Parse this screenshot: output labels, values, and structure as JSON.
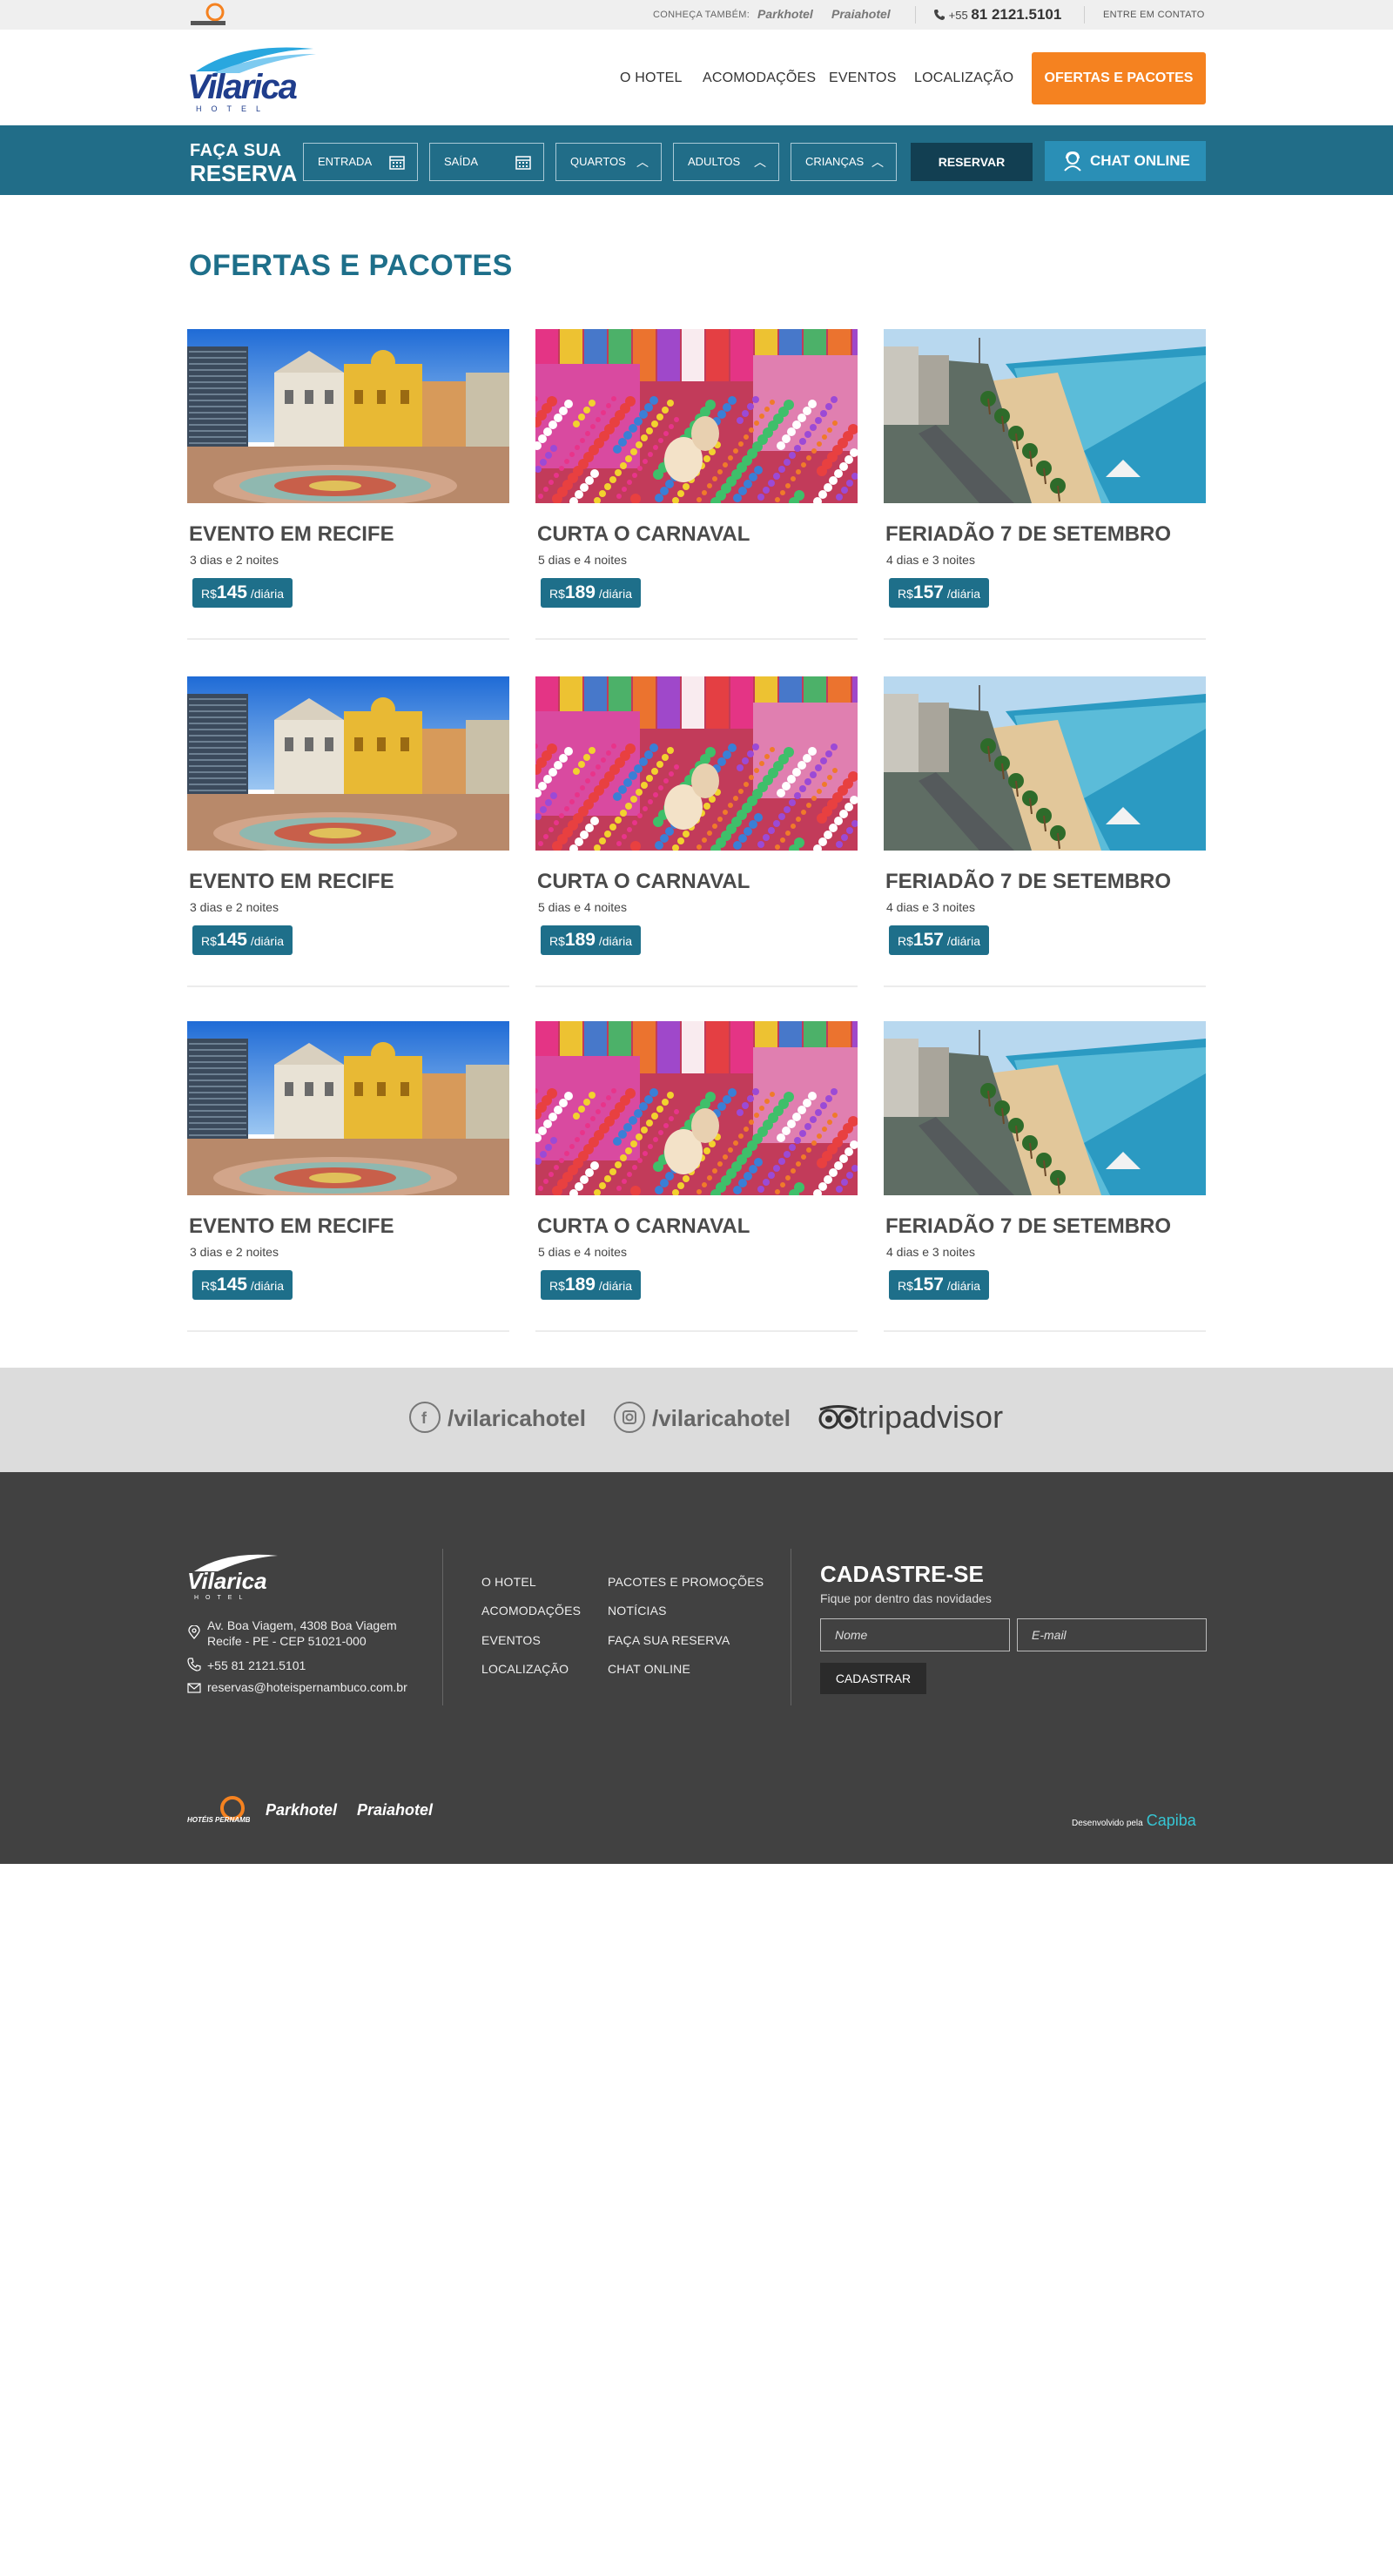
{
  "topbar": {
    "also_label": "CONHEÇA TAMBÉM:",
    "brand1": "Parkhotel",
    "brand2": "Praiahotel",
    "phone_prefix": "+55",
    "phone_number": "81 2121.5101",
    "contact": "ENTRE EM CONTATO"
  },
  "logo": {
    "name": "Vilarica",
    "sub": "HOTEL"
  },
  "nav": {
    "items": [
      "O HOTEL",
      "ACOMODAÇÕES",
      "EVENTOS",
      "LOCALIZAÇÃO"
    ],
    "cta": "OFERTAS E PACOTES"
  },
  "reservation": {
    "title_top": "FAÇA SUA",
    "title_bottom": "RESERVA",
    "entrada": "ENTRADA",
    "saida": "SAÍDA",
    "quartos": "QUARTOS",
    "adultos": "ADULTOS",
    "criancas": "CRIANÇAS",
    "submit": "RESERVAR",
    "chat": "CHAT ONLINE"
  },
  "main": {
    "title": "OFERTAS E PACOTES",
    "cards": [
      {
        "title": "EVENTO EM RECIFE",
        "duration": "3 dias e 2 noites",
        "currency": "R$",
        "price": "145",
        "unit": " /diária"
      },
      {
        "title": "CURTA O CARNAVAL",
        "duration": "5 dias e 4 noites",
        "currency": "R$",
        "price": "189",
        "unit": " /diária"
      },
      {
        "title": "FERIADÃO 7 DE SETEMBRO",
        "duration": "4 dias e 3 noites",
        "currency": "R$",
        "price": "157",
        "unit": " /diária"
      },
      {
        "title": "EVENTO EM RECIFE",
        "duration": "3 dias e 2 noites",
        "currency": "R$",
        "price": "145",
        "unit": " /diária"
      },
      {
        "title": "CURTA O CARNAVAL",
        "duration": "5 dias e 4 noites",
        "currency": "R$",
        "price": "189",
        "unit": " /diária"
      },
      {
        "title": "FERIADÃO 7 DE SETEMBRO",
        "duration": "4 dias e 3 noites",
        "currency": "R$",
        "price": "157",
        "unit": " /diária"
      },
      {
        "title": "EVENTO EM RECIFE",
        "duration": "3 dias e 2 noites",
        "currency": "R$",
        "price": "145",
        "unit": " /diária"
      },
      {
        "title": "CURTA O CARNAVAL",
        "duration": "5 dias e 4 noites",
        "currency": "R$",
        "price": "189",
        "unit": " /diária"
      },
      {
        "title": "FERIADÃO 7 DE SETEMBRO",
        "duration": "4 dias e 3 noites",
        "currency": "R$",
        "price": "157",
        "unit": " /diária"
      }
    ]
  },
  "social": {
    "facebook": "/vilaricahotel",
    "instagram": "/vilaricahotel",
    "tripadvisor": "tripadvisor"
  },
  "footer": {
    "address_line1": "Av. Boa Viagem, 4308 Boa Viagem",
    "address_line2": "Recife - PE - CEP 51021-000",
    "phone": "+55 81 2121.5101",
    "email": "reservas@hoteispernambuco.com.br",
    "links_col1": [
      "O HOTEL",
      "ACOMODAÇÕES",
      "EVENTOS",
      "LOCALIZAÇÃO"
    ],
    "links_col2": [
      "PACOTES E PROMOÇÕES",
      "NOTÍCIAS",
      "FAÇA SUA RESERVA",
      "CHAT ONLINE"
    ],
    "newsletter_title": "CADASTRE-SE",
    "newsletter_sub": "Fique por dentro das novidades",
    "name_placeholder": "Nome",
    "email_placeholder": "E-mail",
    "newsletter_button": "CADASTRAR",
    "bottom_logo1": "HOTÉIS PERNAMBUCO",
    "bottom_logo2": "Parkhotel",
    "bottom_logo3": "Praiahotel",
    "developed_by": "Desenvolvido pela",
    "developer": "Capiba"
  },
  "colors": {
    "accent_orange": "#f58220",
    "primary_teal": "#216d88",
    "title_teal": "#1e6f8a",
    "footer_bg": "#414141"
  }
}
